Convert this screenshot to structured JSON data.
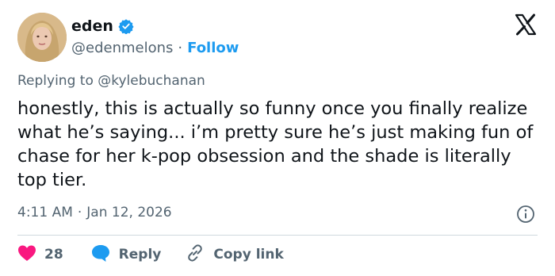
{
  "author": {
    "display_name": "eden",
    "handle": "@edenmelons",
    "separator": "·",
    "follow_label": "Follow"
  },
  "reply_context": "Replying to @kylebuchanan",
  "tweet_text": "honestly, this is actually so funny once you finally realize what he’s saying... i’m pretty sure he’s just making fun of chase for her k-pop obsession and the shade is literally top tier.",
  "meta": {
    "time": "4:11 AM",
    "separator": "·",
    "date": "Jan 12, 2026"
  },
  "actions": {
    "like_count": "28",
    "reply_label": "Reply",
    "copy_link_label": "Copy link"
  },
  "icons": {
    "verified": "verified-badge-icon",
    "logo": "x-logo-icon",
    "info": "info-icon",
    "like": "heart-icon",
    "reply": "speech-bubble-icon",
    "copy": "link-icon"
  },
  "colors": {
    "accent": "#1d9bf0",
    "like": "#f91880",
    "secondary_text": "#536471",
    "primary_text": "#0f1419"
  }
}
